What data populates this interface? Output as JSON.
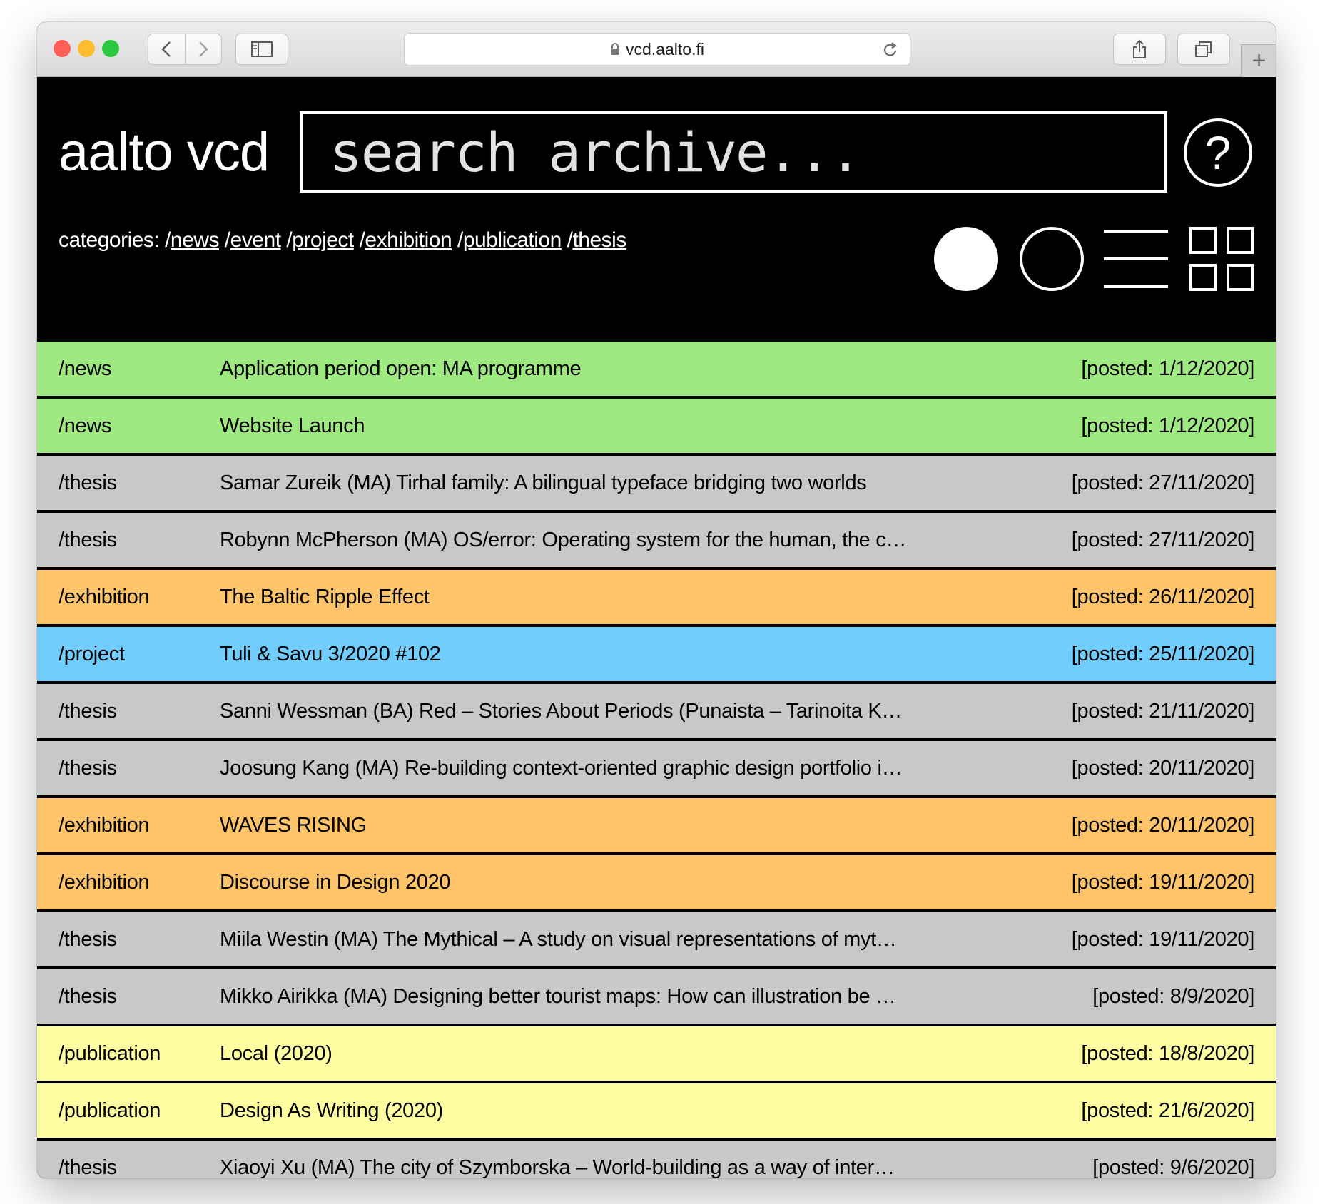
{
  "browser": {
    "url": "vcd.aalto.fi",
    "traffic_lights": {
      "close": "#fe5f57",
      "minimize": "#febc2e",
      "zoom": "#28c840"
    },
    "icons": [
      "back-icon",
      "forward-icon",
      "sidebar-icon",
      "lock-icon",
      "reload-icon",
      "share-icon",
      "tabs-icon",
      "plus-icon"
    ],
    "new_tab_label": "+"
  },
  "header": {
    "logo": "aalto vcd",
    "search": {
      "placeholder": "search archive..."
    },
    "help_label": "?",
    "categories_prefix": "categories:",
    "categories": [
      {
        "prefix": " /",
        "label": "news"
      },
      {
        "prefix": " /",
        "label": "event"
      },
      {
        "prefix": " /",
        "label": "project"
      },
      {
        "prefix": " /",
        "label": "exhibition"
      },
      {
        "prefix": " /",
        "label": "publication"
      },
      {
        "prefix": " /",
        "label": "thesis"
      }
    ],
    "view_buttons": [
      "filled-circle-icon",
      "outline-circle-icon",
      "list-icon",
      "grid-icon"
    ]
  },
  "colors": {
    "news": "#9fea80",
    "thesis": "#c8c8c8",
    "exhibition": "#fec46a",
    "project": "#71cdfc",
    "publication": "#fdfca0"
  },
  "items": [
    {
      "category": "/news",
      "type": "news",
      "title": "Application period open: MA programme",
      "date": "[posted: 1/12/2020]"
    },
    {
      "category": "/news",
      "type": "news",
      "title": "Website Launch",
      "date": "[posted: 1/12/2020]"
    },
    {
      "category": "/thesis",
      "type": "thesis",
      "title": "Samar Zureik (MA) Tirhal family: A bilingual typeface bridging two worlds",
      "date": "[posted: 27/11/2020]"
    },
    {
      "category": "/thesis",
      "type": "thesis",
      "title": "Robynn McPherson (MA) OS/error: Operating system for the human, the c…",
      "date": "[posted: 27/11/2020]"
    },
    {
      "category": "/exhibition",
      "type": "exhibition",
      "title": "The Baltic Ripple Effect",
      "date": "[posted: 26/11/2020]"
    },
    {
      "category": "/project",
      "type": "project",
      "title": "Tuli & Savu 3/2020 #102",
      "date": "[posted: 25/11/2020]"
    },
    {
      "category": "/thesis",
      "type": "thesis",
      "title": "Sanni Wessman (BA) Red – Stories About Periods (Punaista – Tarinoita K…",
      "date": "[posted: 21/11/2020]"
    },
    {
      "category": "/thesis",
      "type": "thesis",
      "title": "Joosung Kang (MA) Re-building context-oriented graphic design portfolio i…",
      "date": "[posted: 20/11/2020]"
    },
    {
      "category": "/exhibition",
      "type": "exhibition",
      "title": "WAVES RISING",
      "date": "[posted: 20/11/2020]"
    },
    {
      "category": "/exhibition",
      "type": "exhibition",
      "title": "Discourse in Design 2020",
      "date": "[posted: 19/11/2020]"
    },
    {
      "category": "/thesis",
      "type": "thesis",
      "title": "Miila Westin (MA) The Mythical – A study on visual representations of myt…",
      "date": "[posted: 19/11/2020]"
    },
    {
      "category": "/thesis",
      "type": "thesis",
      "title": "Mikko Airikka (MA) Designing better tourist maps: How can illustration be …",
      "date": "[posted: 8/9/2020]"
    },
    {
      "category": "/publication",
      "type": "publication",
      "title": "Local (2020)",
      "date": "[posted: 18/8/2020]"
    },
    {
      "category": "/publication",
      "type": "publication",
      "title": "Design As Writing (2020)",
      "date": "[posted: 21/6/2020]"
    },
    {
      "category": "/thesis",
      "type": "thesis",
      "title": "Xiaoyi Xu (MA) The city of Szymborska – World-building as a way of inter…",
      "date": "[posted: 9/6/2020]"
    }
  ]
}
